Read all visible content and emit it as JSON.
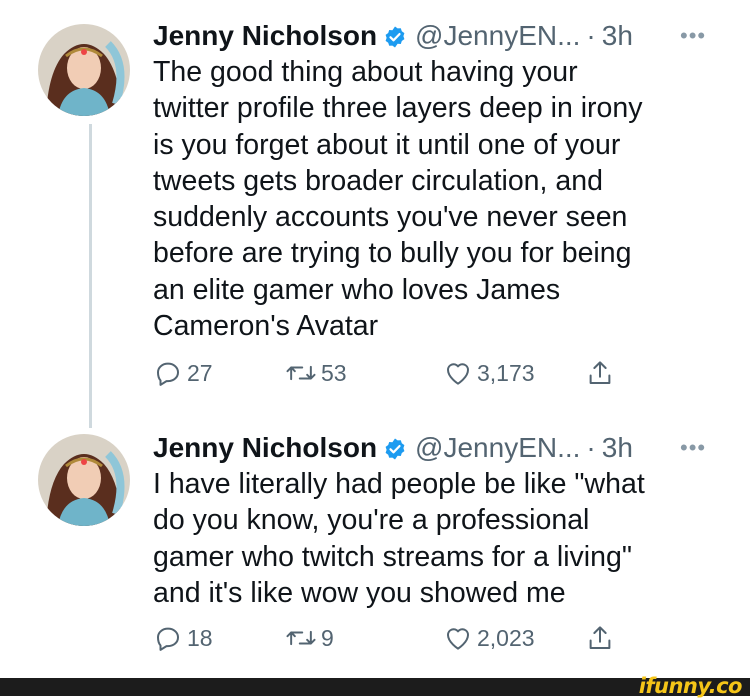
{
  "tweets": [
    {
      "name": "Jenny Nicholson",
      "handle": "@JennyEN...",
      "separator": "·",
      "time": "3h",
      "more": "•••",
      "text": "The good thing about having your\ntwitter profile three layers deep in irony\nis you forget about it until one of your\ntweets gets broader circulation, and\nsuddenly accounts you've never seen\nbefore are trying to bully you for being\nan elite gamer who loves James\nCameron's Avatar",
      "replies": "27",
      "retweets": "53",
      "likes": "3,173"
    },
    {
      "name": "Jenny Nicholson",
      "handle": "@JennyEN...",
      "separator": "·",
      "time": "3h",
      "more": "•••",
      "text": "I have literally had people be like \"what\ndo you know, you're a professional\ngamer who twitch streams for a living\"\nand it's like wow you showed me",
      "replies": "18",
      "retweets": "9",
      "likes": "2,023"
    }
  ],
  "footer": {
    "watermark": "ifunny.co"
  },
  "colors": {
    "verified": "#1d9bf0",
    "muted": "#536471",
    "thread_line": "#cfd9de"
  },
  "icons": [
    "reply-icon",
    "retweet-icon",
    "like-icon",
    "share-icon",
    "verified-badge-icon",
    "more-icon"
  ]
}
